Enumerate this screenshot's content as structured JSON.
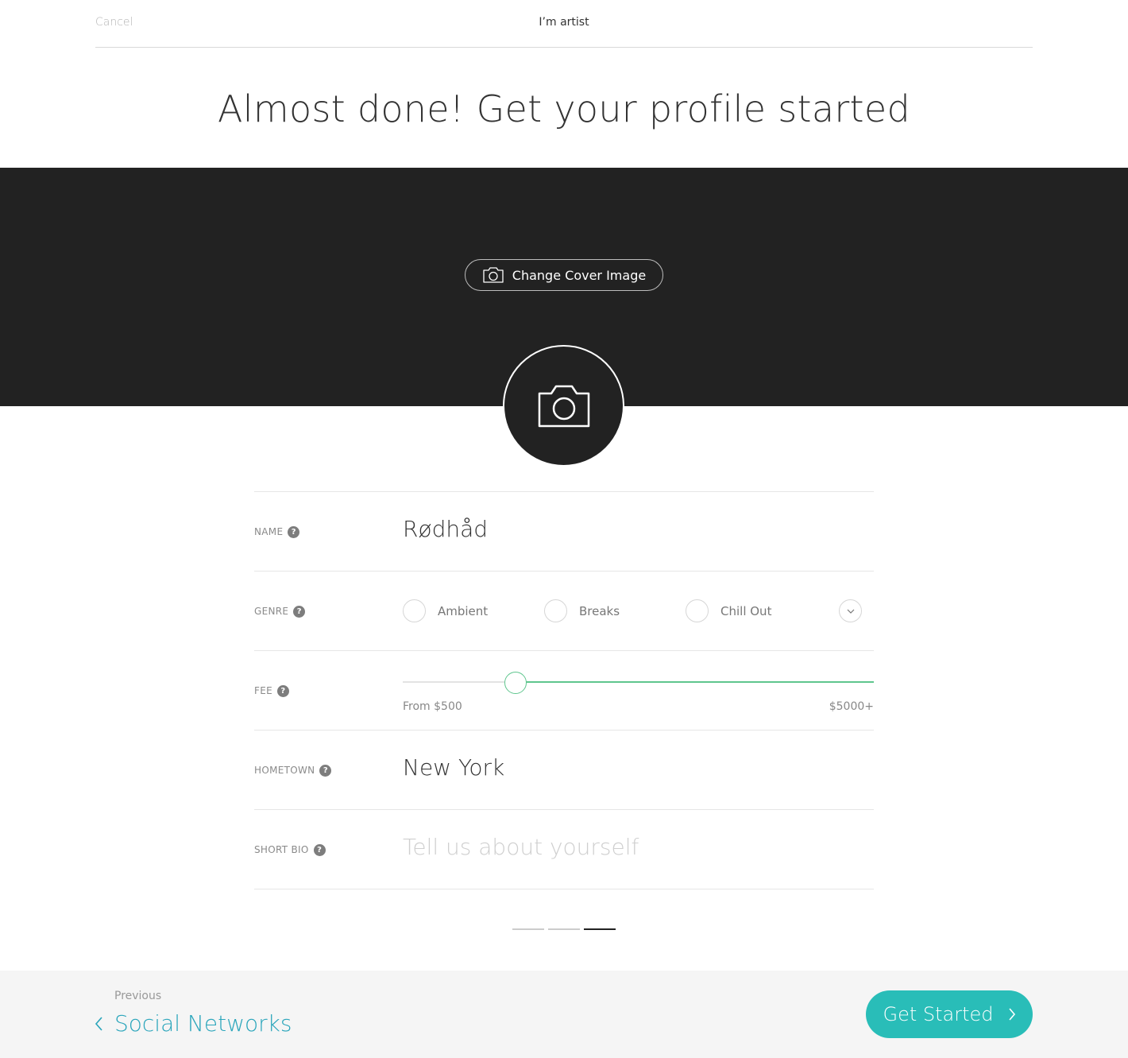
{
  "header": {
    "cancel_label": "Cancel",
    "title": "I’m artist"
  },
  "headline": "Almost done! Get your profile started",
  "cover": {
    "button_label": "Change Cover Image",
    "icon": "camera-icon",
    "background": "#222222"
  },
  "avatar": {
    "icon": "camera-icon"
  },
  "form": {
    "name": {
      "label": "NAME",
      "value": "Rødhåd"
    },
    "genre": {
      "label": "GENRE",
      "options": [
        "Ambient",
        "Breaks",
        "Chill Out"
      ]
    },
    "fee": {
      "label": "FEE",
      "min_label": "From $500",
      "max_label": "$5000+",
      "value_fraction": 0.24,
      "accent": "#5fc68e"
    },
    "hometown": {
      "label": "HOMETOWN",
      "value": "New York"
    },
    "bio": {
      "label": "SHORT BIO",
      "placeholder": "Tell us about yourself"
    }
  },
  "pager": {
    "steps": 3,
    "current": 3
  },
  "footer": {
    "previous_caption": "Previous",
    "previous_label": "Social Networks",
    "cta_label": "Get Started",
    "cta_color": "#29bdb8",
    "link_color": "#2aa5bb"
  }
}
